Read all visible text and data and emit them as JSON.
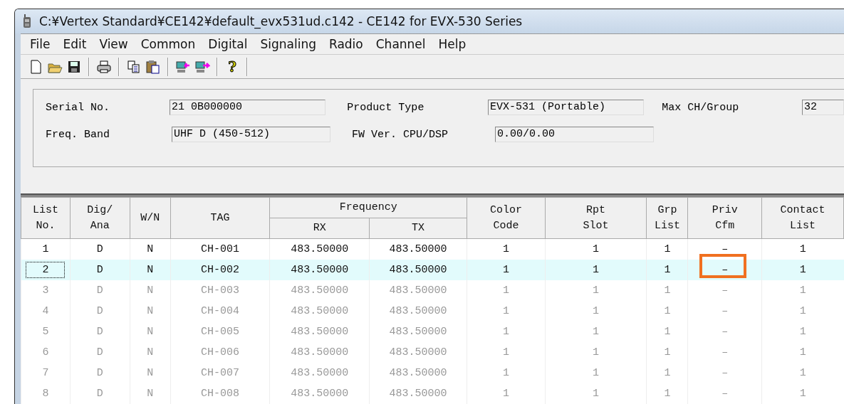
{
  "window": {
    "title": "C:¥Vertex Standard¥CE142¥default_evx531ud.c142 - CE142 for EVX-530 Series"
  },
  "menu": [
    "File",
    "Edit",
    "View",
    "Common",
    "Digital",
    "Signaling",
    "Radio",
    "Channel",
    "Help"
  ],
  "toolbar": [
    {
      "kind": "new"
    },
    {
      "kind": "open"
    },
    {
      "kind": "save"
    },
    {
      "kind": "sep"
    },
    {
      "kind": "print"
    },
    {
      "kind": "sep"
    },
    {
      "kind": "copy"
    },
    {
      "kind": "paste"
    },
    {
      "kind": "sep"
    },
    {
      "kind": "read"
    },
    {
      "kind": "write"
    },
    {
      "kind": "sep"
    },
    {
      "kind": "help",
      "glyph": "?"
    }
  ],
  "info": [
    [
      {
        "label": "Serial No.",
        "value": "21 0B000000"
      },
      {
        "label": "Product Type",
        "value": "EVX-531 (Portable)"
      },
      {
        "label": "Max CH/Group",
        "value": "32"
      }
    ],
    [
      {
        "label": "Freq. Band",
        "value": "UHF D (450-512)"
      },
      {
        "label": "FW Ver. CPU/DSP",
        "value": "0.00/0.00"
      }
    ]
  ],
  "table": {
    "columns": [
      {
        "label": [
          "List",
          "No."
        ]
      },
      {
        "label": [
          "Dig/",
          "Ana"
        ]
      },
      {
        "label": [
          "W/N"
        ]
      },
      {
        "label": [
          "TAG"
        ]
      },
      {
        "label": [
          "Frequency"
        ],
        "colspan": 2,
        "children": [
          {
            "label": [
              "RX"
            ]
          },
          {
            "label": [
              "TX"
            ]
          }
        ]
      },
      {
        "label": [
          "Color",
          "Code"
        ]
      },
      {
        "label": [
          "Rpt",
          "Slot"
        ]
      },
      {
        "label": [
          "Grp",
          "List"
        ]
      },
      {
        "label": [
          "Priv",
          "Cfm"
        ]
      },
      {
        "label": [
          "Contact",
          "List"
        ]
      }
    ],
    "rows": [
      {
        "cells": [
          "1",
          "D",
          "N",
          "CH-001",
          "483.50000",
          "483.50000",
          "1",
          "1",
          "1",
          "–",
          "1"
        ],
        "enabled": true,
        "selected": false,
        "callout": false
      },
      {
        "cells": [
          "2",
          "D",
          "N",
          "CH-002",
          "483.50000",
          "483.50000",
          "1",
          "1",
          "1",
          "–",
          "1"
        ],
        "enabled": true,
        "selected": true,
        "callout": true
      },
      {
        "cells": [
          "3",
          "D",
          "N",
          "CH-003",
          "483.50000",
          "483.50000",
          "1",
          "1",
          "1",
          "–",
          "1"
        ],
        "enabled": false,
        "selected": false,
        "callout": false
      },
      {
        "cells": [
          "4",
          "D",
          "N",
          "CH-004",
          "483.50000",
          "483.50000",
          "1",
          "1",
          "1",
          "–",
          "1"
        ],
        "enabled": false,
        "selected": false,
        "callout": false
      },
      {
        "cells": [
          "5",
          "D",
          "N",
          "CH-005",
          "483.50000",
          "483.50000",
          "1",
          "1",
          "1",
          "–",
          "1"
        ],
        "enabled": false,
        "selected": false,
        "callout": false
      },
      {
        "cells": [
          "6",
          "D",
          "N",
          "CH-006",
          "483.50000",
          "483.50000",
          "1",
          "1",
          "1",
          "–",
          "1"
        ],
        "enabled": false,
        "selected": false,
        "callout": false
      },
      {
        "cells": [
          "7",
          "D",
          "N",
          "CH-007",
          "483.50000",
          "483.50000",
          "1",
          "1",
          "1",
          "–",
          "1"
        ],
        "enabled": false,
        "selected": false,
        "callout": false
      },
      {
        "cells": [
          "8",
          "D",
          "N",
          "CH-008",
          "483.50000",
          "483.50000",
          "1",
          "1",
          "1",
          "–",
          "1"
        ],
        "enabled": false,
        "selected": false,
        "callout": false
      }
    ]
  }
}
